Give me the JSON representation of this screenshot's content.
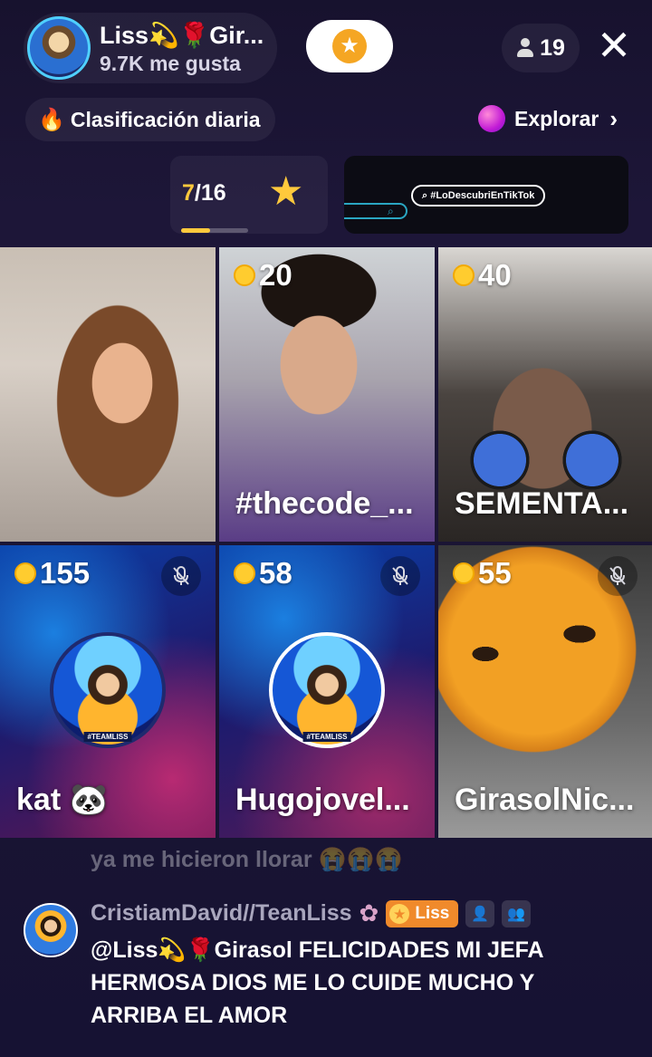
{
  "header": {
    "host_name": "Liss💫🌹Gir...",
    "host_likes": "9.7K me gusta",
    "viewer_count": "19",
    "close_label": "✕"
  },
  "chips": {
    "ranking_label": "Clasificación diaria",
    "explore_label": "Explorar"
  },
  "progress": {
    "current": "7",
    "total": "/16",
    "fraction": 0.4375
  },
  "promo": {
    "hashtag": "#LoDescubriEnTikTok"
  },
  "guests": [
    {
      "coins": "",
      "name": "",
      "muted": false
    },
    {
      "coins": "20",
      "name": "#thecode_...",
      "muted": false
    },
    {
      "coins": "40",
      "name": "SEMENTA...",
      "muted": false
    },
    {
      "coins": "155",
      "name": "kat 🐼",
      "muted": true
    },
    {
      "coins": "58",
      "name": "Hugojovel...",
      "muted": true
    },
    {
      "coins": "55",
      "name": "GirasolNic...",
      "muted": true
    }
  ],
  "avatar_captions": [
    "#TEAMLISS",
    "#TEAMLISS"
  ],
  "chat": {
    "faded_top": "ya me hicieron llorar 😭😭😭",
    "message": {
      "user": "CristiamDavid//TeanLiss",
      "fan_badge": "Liss",
      "text": "@Liss💫🌹Girasol FELICIDADES MI JEFA HERMOSA DIOS ME LO CUIDE  MUCHO Y ARRIBA EL AMOR"
    }
  },
  "colors": {
    "background": "#1a1533",
    "accent_gold": "#ffc93c",
    "fan_badge": "#f08a2b"
  }
}
